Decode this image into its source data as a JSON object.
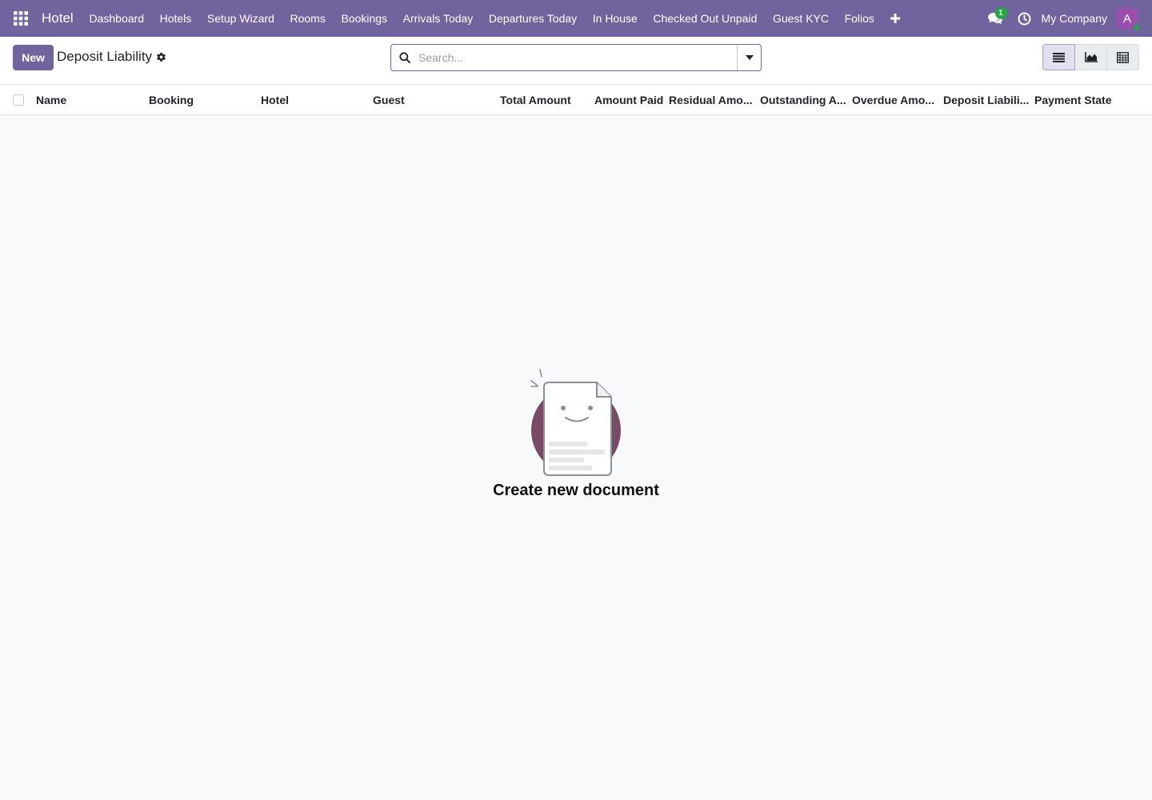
{
  "navbar": {
    "app_name": "Hotel",
    "menu": [
      "Dashboard",
      "Hotels",
      "Setup Wizard",
      "Rooms",
      "Bookings",
      "Arrivals Today",
      "Departures Today",
      "In House",
      "Checked Out Unpaid",
      "Guest KYC",
      "Folios"
    ],
    "messages_count": "1",
    "company": "My Company",
    "avatar_initial": "A",
    "brand_color": "#71639e"
  },
  "control_panel": {
    "new_label": "New",
    "title": "Deposit Liability",
    "search_placeholder": "Search..."
  },
  "list": {
    "columns": [
      "Name",
      "Booking",
      "Hotel",
      "Guest",
      "Total Amount",
      "Amount Paid",
      "Residual Amo...",
      "Outstanding A...",
      "Overdue Amo...",
      "Deposit Liabili...",
      "Payment State"
    ],
    "rows": []
  },
  "empty_state": {
    "title": "Create new document"
  },
  "icons": {
    "apps": "apps-grid-icon",
    "plus": "plus-icon",
    "chat": "chat-icon",
    "clock": "clock-icon",
    "gear": "gear-icon",
    "search": "search-icon",
    "dropdown": "caret-down-icon",
    "list_view": "list-view-icon",
    "graph_view": "area-chart-icon",
    "pivot_view": "pivot-table-icon"
  }
}
